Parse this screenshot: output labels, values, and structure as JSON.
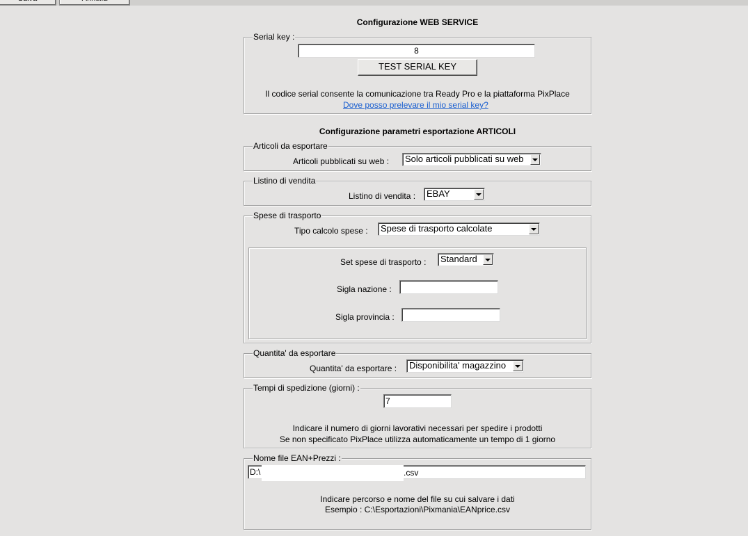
{
  "toolbar": {
    "save_label": "Salva",
    "cancel_label": "Annulla"
  },
  "web_service": {
    "title": "Configurazione WEB SERVICE",
    "serial_legend": "Serial key :",
    "serial_value": "8",
    "test_button": "TEST SERIAL KEY",
    "info_text": "Il codice serial consente la comunicazione tra Ready Pro e la piattaforma PixPlace",
    "help_link": "Dove posso prelevare il mio serial key?"
  },
  "articoli": {
    "title": "Configurazione parametri esportazione ARTICOLI",
    "export_group": {
      "legend": "Articoli da esportare",
      "label": "Articoli pubblicati su web :",
      "value": "Solo articoli pubblicati su web"
    },
    "listino_group": {
      "legend": "Listino di vendita",
      "label": "Listino di vendita :",
      "value": "EBAY"
    },
    "spese_group": {
      "legend": "Spese di trasporto",
      "tipo_label": "Tipo calcolo spese :",
      "tipo_value": "Spese di trasporto calcolate",
      "set_label": "Set spese di trasporto :",
      "set_value": "Standard",
      "nazione_label": "Sigla nazione :",
      "nazione_value": "",
      "provincia_label": "Sigla provincia :",
      "provincia_value": ""
    },
    "quantita_group": {
      "legend": "Quantita' da esportare",
      "label": "Quantita' da esportare :",
      "value": "Disponibilita' magazzino"
    },
    "tempi_group": {
      "legend": "Tempi di spedizione (giorni) :",
      "value": "7",
      "info_line1": "Indicare il numero di giorni lavorativi necessari per spedire i prodotti",
      "info_line2": "Se non specificato PixPlace utilizza automaticamente un tempo di 1 giorno"
    },
    "file_group": {
      "legend": "Nome file EAN+Prezzi :",
      "path_prefix": "D:\\",
      "path_suffix": ".csv",
      "info_line1": "Indicare percorso e nome del file su cui salvare i dati",
      "info_line2": "Esempio : C:\\Esportazioni\\Pixmania\\EANprice.csv"
    }
  }
}
